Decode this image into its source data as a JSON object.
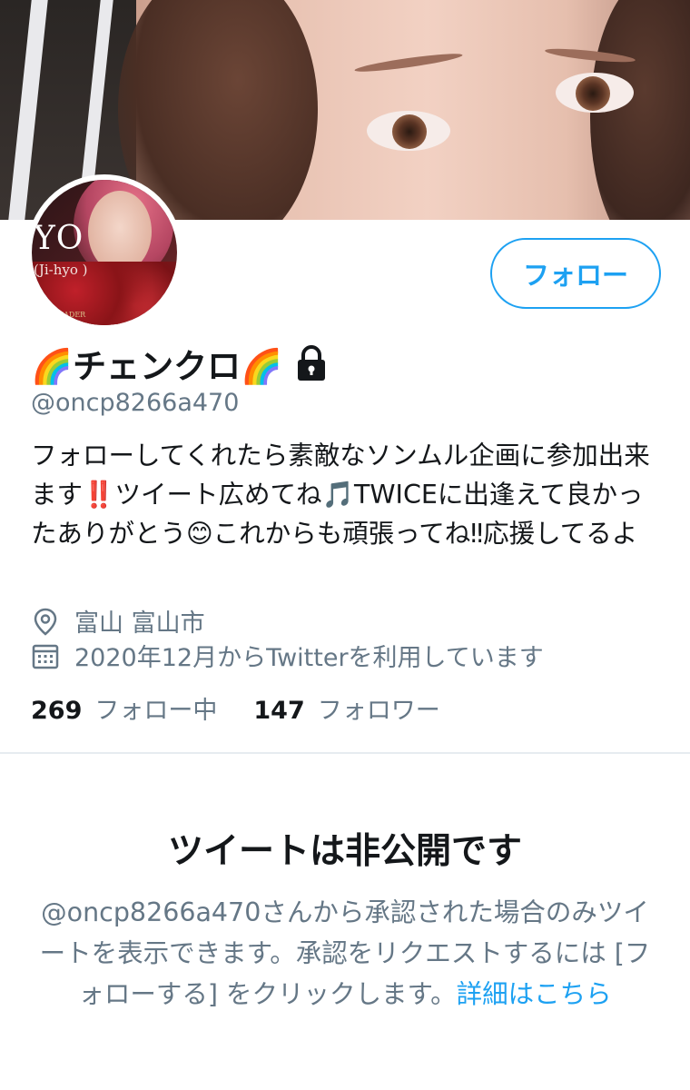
{
  "profile": {
    "display_name": "🌈チェンクロ🌈",
    "handle": "@oncp8266a470",
    "bio": "フォローしてくれたら素敵なソンムル企画に参加出来ます‼️ツイート広めてね🎵TWICEに出逢えて良かったありがとう😊これからも頑張ってね‼︎応援してるよ",
    "location": "富山 富山市",
    "joined": "2020年12月からTwitterを利用しています",
    "following_count": "269",
    "following_label": "フォロー中",
    "followers_count": "147",
    "followers_label": "フォロワー",
    "avatar_text": {
      "yo": "YO",
      "jihyo": "(Ji-hyo )",
      "leader": "LEADER"
    }
  },
  "follow_button": {
    "label": "フォロー"
  },
  "private_notice": {
    "title": "ツイートは非公開です",
    "description": "@oncp8266a470さんから承認された場合のみツイートを表示できます。承認をリクエストするには [フォローする] をクリックします。",
    "link_label": "詳細はこちら"
  },
  "colors": {
    "accent": "#1da1f2",
    "text_primary": "#14171a",
    "text_secondary": "#657786",
    "divider": "#e6ecf0"
  },
  "icons": {
    "lock": "lock-icon",
    "location": "location-pin-icon",
    "calendar": "calendar-icon"
  }
}
